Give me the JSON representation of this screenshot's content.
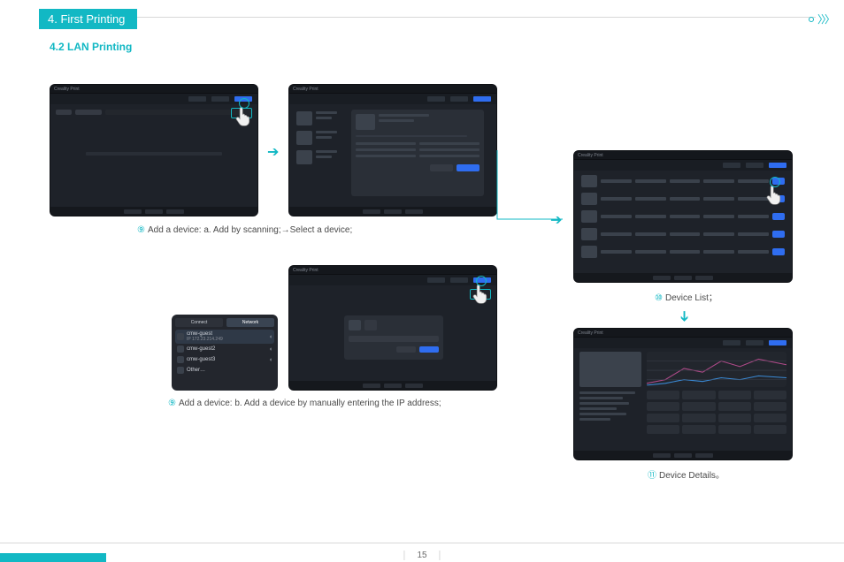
{
  "header": {
    "title": "4. First Printing"
  },
  "subheader": "4.2 LAN Printing",
  "captions": {
    "step9a_num": "⑨",
    "step9a": "Add a device: a. Add by scanning;→Select a device;",
    "step9b_num": "⑨",
    "step9b": "Add a device: b. Add a device by manually entering the IP address;",
    "step10_num": "⑩",
    "step10": "Device List；",
    "step11_num": "⑪",
    "step11": "Device Details。"
  },
  "app": {
    "title_label": "Creality Print"
  },
  "netbox": {
    "tabs": [
      "Connect",
      "Network"
    ],
    "items": [
      {
        "name": "cmw-guest",
        "ip": "IP 172.23.214.249"
      },
      {
        "name": "cmw-guest2",
        "ip": ""
      },
      {
        "name": "cmw-guest3",
        "ip": ""
      },
      {
        "name": "Other…",
        "ip": ""
      }
    ]
  },
  "page_number": "15"
}
